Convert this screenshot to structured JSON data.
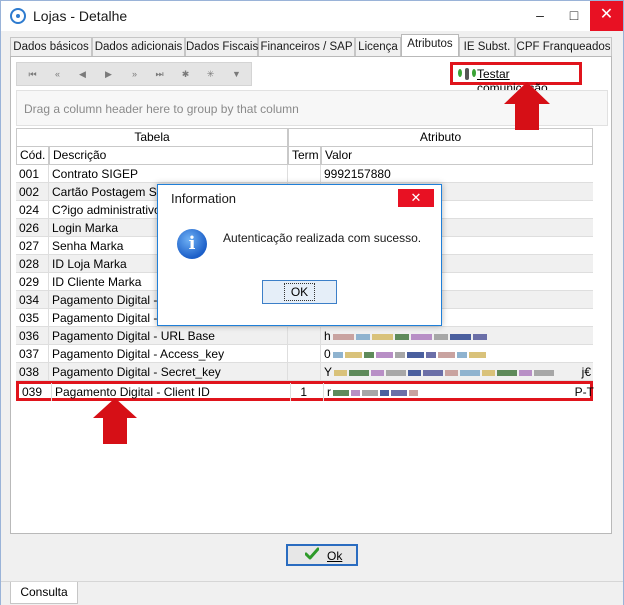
{
  "window": {
    "title": "Lojas - Detalhe",
    "minimize": "–",
    "maximize": "□",
    "close": "✕"
  },
  "tabs": [
    {
      "label": "Dados básicos",
      "active": false
    },
    {
      "label": "Dados adicionais",
      "active": false
    },
    {
      "label": "Dados Fiscais",
      "active": false
    },
    {
      "label": "Financeiros / SAP",
      "active": false
    },
    {
      "label": "Licença",
      "active": false
    },
    {
      "label": "Atributos",
      "active": true
    },
    {
      "label": "IE Subst.",
      "active": false
    },
    {
      "label": "CPF Franqueados",
      "active": false
    }
  ],
  "navigator": {
    "buttons": [
      "first",
      "prev-page",
      "prev",
      "next",
      "next-page",
      "last",
      "insert",
      "delete",
      "filter"
    ],
    "glyphs": [
      "⏮",
      "«",
      "◀",
      "▶",
      "»",
      "⏭",
      "✱",
      "✳",
      "▼"
    ]
  },
  "toolbar": {
    "test_label": "Testar comunicação"
  },
  "group_panel": {
    "hint": "Drag a column header here to group by that column"
  },
  "grid": {
    "bands": {
      "tabela": "Tabela",
      "atributo": "Atributo"
    },
    "columns": {
      "cod": "Cód.",
      "descricao": "Descrição",
      "term": "Term",
      "valor": "Valor"
    },
    "rows": [
      {
        "cod": "001",
        "descricao": "Contrato SIGEP",
        "term": "",
        "valor": "9992157880",
        "redacted": false
      },
      {
        "cod": "002",
        "descricao": "Cartão Postagem SIG",
        "term": "",
        "valor": "",
        "redacted": false
      },
      {
        "cod": "024",
        "descricao": "C?igo administrativo S",
        "term": "",
        "valor": "",
        "redacted": false
      },
      {
        "cod": "026",
        "descricao": "Login Marka",
        "term": "",
        "valor": "",
        "redacted": false
      },
      {
        "cod": "027",
        "descricao": "Senha Marka",
        "term": "",
        "valor": "",
        "redacted": false
      },
      {
        "cod": "028",
        "descricao": "ID Loja Marka",
        "term": "",
        "valor": "",
        "redacted": false
      },
      {
        "cod": "029",
        "descricao": "ID Cliente Marka",
        "term": "",
        "valor": "",
        "redacted": false
      },
      {
        "cod": "034",
        "descricao": "Pagamento Digital - A",
        "term": "",
        "valor": "",
        "redacted": false
      },
      {
        "cod": "035",
        "descricao": "Pagamento Digital - G",
        "term": "",
        "valor": "",
        "redacted": false
      },
      {
        "cod": "036",
        "descricao": "Pagamento Digital - URL Base",
        "term": "",
        "valor": "h",
        "redacted": true
      },
      {
        "cod": "037",
        "descricao": "Pagamento Digital - Access_key",
        "term": "",
        "valor": "0",
        "redacted": true
      },
      {
        "cod": "038",
        "descricao": "Pagamento Digital - Secret_key",
        "term": "",
        "valor": "Y",
        "redacted": true
      },
      {
        "cod": "039",
        "descricao": "Pagamento Digital - Client ID",
        "term": "1",
        "valor": "r",
        "redacted": true,
        "selected": true
      }
    ],
    "row_38_tail": "j€",
    "row_39_tail": "P-T"
  },
  "footer": {
    "ok_label": "Ok",
    "status_tab": "Consulta"
  },
  "dialog": {
    "title": "Information",
    "close": "✕",
    "message": "Autenticação realizada com sucesso.",
    "icon_glyph": "i",
    "ok_label": "OK"
  },
  "colors": {
    "highlight_red": "#e0141c",
    "arrow_red": "#d60f16",
    "close_red": "#e81123",
    "accent_blue": "#1f7fd8"
  }
}
